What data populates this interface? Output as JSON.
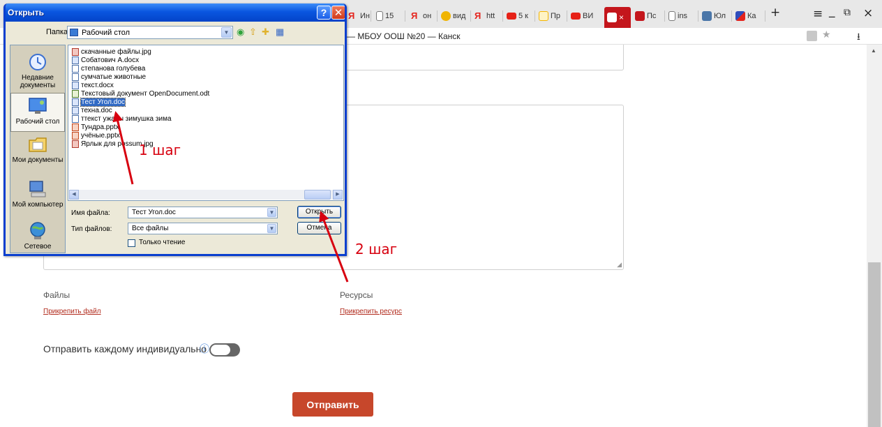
{
  "browser": {
    "tabs": [
      {
        "label": "Ин",
        "icon": "yandex-icon",
        "color": "#e5241d"
      },
      {
        "label": "15",
        "icon": "document-icon",
        "color": "#777777"
      },
      {
        "label": "он",
        "icon": "yandex-icon",
        "color": "#e5241d"
      },
      {
        "label": "вид",
        "icon": "video-play-icon",
        "color": "#f0b400"
      },
      {
        "label": "htt",
        "icon": "yandex-icon",
        "color": "#e5241d"
      },
      {
        "label": "5 к",
        "icon": "youtube-icon",
        "color": "#e62117"
      },
      {
        "label": "Пр",
        "icon": "slides-icon",
        "color": "#f4b400"
      },
      {
        "label": "ВИ",
        "icon": "youtube-icon",
        "color": "#e62117"
      },
      {
        "label": "Пс",
        "icon": "blog-icon",
        "color": "#c4161c"
      },
      {
        "label": "ins",
        "icon": "document-icon",
        "color": "#777777"
      },
      {
        "label": "Юл",
        "icon": "vk-icon",
        "color": "#4a76a8"
      },
      {
        "label": "Ка",
        "icon": "app-icon",
        "color": "#2f4dbd"
      }
    ],
    "active_tab_close": "×",
    "new_tab": "+",
    "window_controls": [
      "≡",
      "_",
      "⧉",
      "×"
    ],
    "page_title": "— МБОУ ООШ №20 — Канск"
  },
  "page": {
    "files_label": "Файлы",
    "attach_file": "Прикрепить файл",
    "resources_label": "Ресурсы",
    "attach_resource": "Прикрепить ресурс",
    "send_individually_label": "Отправить каждому индивидуально",
    "info_glyph": "ⓘ",
    "send_button": "Отправить"
  },
  "dialog": {
    "title": "Открыть",
    "help_glyph": "?",
    "close_glyph": "✕",
    "folder_label": "Папка:",
    "folder_value": "Рабочий стол",
    "places": [
      {
        "name": "place-recent",
        "label": "Недавние документы",
        "icon": "recent-documents-icon"
      },
      {
        "name": "place-desktop",
        "label": "Рабочий стол",
        "icon": "desktop-icon"
      },
      {
        "name": "place-my-documents",
        "label": "Мои документы",
        "icon": "my-documents-icon"
      },
      {
        "name": "place-my-computer",
        "label": "Мой компьютер",
        "icon": "my-computer-icon"
      },
      {
        "name": "place-network",
        "label": "Сетевое",
        "icon": "network-icon"
      }
    ],
    "files": [
      {
        "name": "скачанные файлы.jpg",
        "icon": "image-file-icon"
      },
      {
        "name": "Собатович А.docx",
        "icon": "word-file-icon"
      },
      {
        "name": "степанова голубева",
        "icon": "document-file-icon"
      },
      {
        "name": "сумчатые животные",
        "icon": "document-file-icon"
      },
      {
        "name": "текст.docx",
        "icon": "word-file-icon"
      },
      {
        "name": "Текстовый документ OpenDocument.odt",
        "icon": "odt-file-icon"
      },
      {
        "name": "Тест Угол.doc",
        "icon": "word-file-icon",
        "selected": true
      },
      {
        "name": "техна.doc",
        "icon": "word-file-icon"
      },
      {
        "name": "ттекст ужасы зимушка зима",
        "icon": "document-file-icon"
      },
      {
        "name": "Тундра.pptx",
        "icon": "powerpoint-file-icon"
      },
      {
        "name": "учёные.pptx",
        "icon": "powerpoint-file-icon"
      },
      {
        "name": "Ярлык для possum.jpg",
        "icon": "shortcut-file-icon"
      }
    ],
    "filename_label": "Имя файла:",
    "filename_value": "Тест Угол.doc",
    "filetype_label": "Тип файлов:",
    "filetype_value": "Все файлы",
    "readonly_label": "Только чтение",
    "open_button": "Открыть",
    "cancel_button": "Отмена"
  },
  "annotations": {
    "step1": "1  шаг",
    "step2": "2  шаг",
    "color": "#d7000f"
  },
  "colors": {
    "accent": "#c7472b",
    "link": "#b12a1c",
    "xp_blue": "#0a56e0",
    "selection": "#316ac5"
  }
}
